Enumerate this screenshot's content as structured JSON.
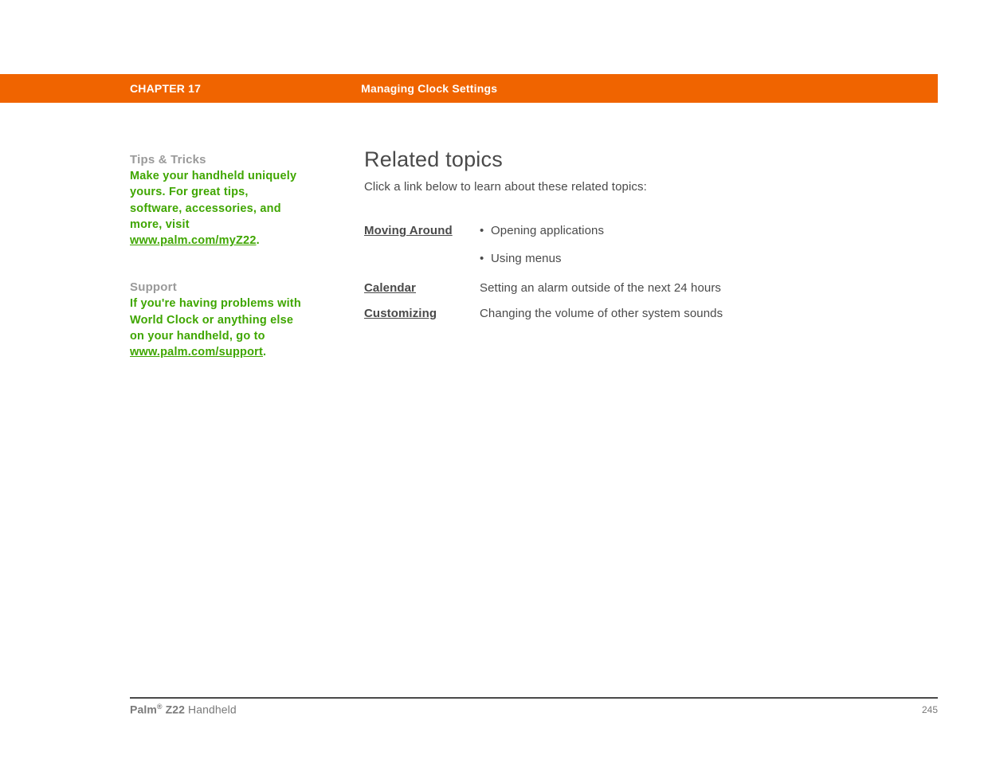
{
  "header": {
    "chapter": "CHAPTER 17",
    "title": "Managing Clock Settings"
  },
  "sidebar": {
    "tips": {
      "heading": "Tips & Tricks",
      "text": "Make your handheld uniquely yours. For great tips, software, accessories, and more, visit ",
      "link": "www.palm.com/myZ22",
      "period": "."
    },
    "support": {
      "heading": "Support",
      "text": "If you're having problems with World Clock or anything else on your handheld, go to ",
      "link": "www.palm.com/support",
      "period": "."
    }
  },
  "main": {
    "heading": "Related topics",
    "subtext": "Click a link below to learn about these related topics:",
    "topics": [
      {
        "link": "Moving Around",
        "bullets": [
          "Opening applications",
          "Using menus"
        ]
      },
      {
        "link": "Calendar",
        "description": "Setting an alarm outside of the next 24 hours"
      },
      {
        "link": "Customizing",
        "description": "Changing the volume of other system sounds"
      }
    ]
  },
  "footer": {
    "brand_bold": "Palm",
    "brand_sup": "®",
    "brand_model": " Z22",
    "brand_suffix": " Handheld",
    "page_number": "245"
  }
}
